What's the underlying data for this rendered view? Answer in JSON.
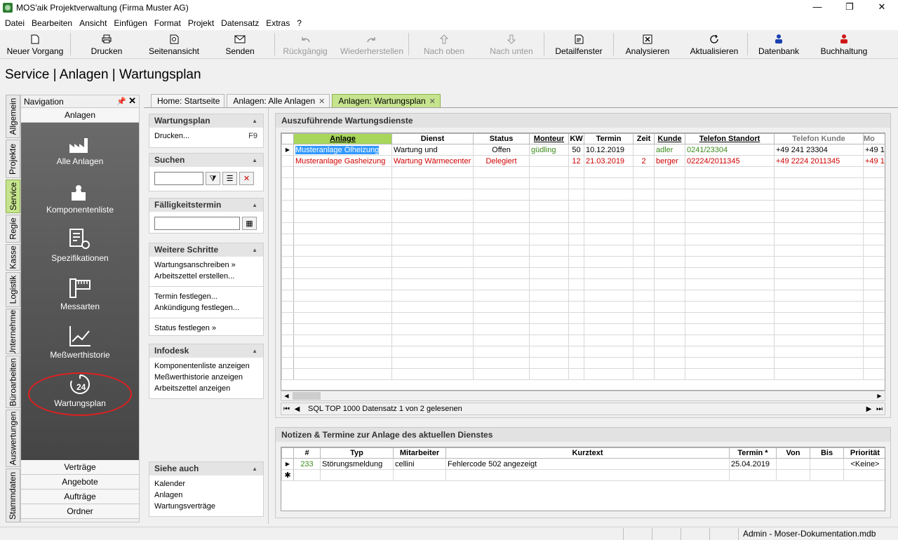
{
  "window": {
    "title": "MOS'aik Projektverwaltung (Firma Muster AG)",
    "minimize": "—",
    "maximize": "❐",
    "close": "✕"
  },
  "menu": [
    "Datei",
    "Bearbeiten",
    "Ansicht",
    "Einfügen",
    "Format",
    "Projekt",
    "Datensatz",
    "Extras",
    "?"
  ],
  "toolbar": {
    "new": "Neuer Vorgang",
    "print": "Drucken",
    "preview": "Seitenansicht",
    "send": "Senden",
    "undo": "Rückgängig",
    "redo": "Wiederherstellen",
    "up": "Nach oben",
    "down": "Nach unten",
    "detail": "Detailfenster",
    "analyze": "Analysieren",
    "refresh": "Aktualisieren",
    "database": "Datenbank",
    "accounting": "Buchhaltung"
  },
  "page_title": "Service | Anlagen | Wartungsplan",
  "vtabs": [
    "Allgemein",
    "Projekte",
    "Service",
    "Regie",
    "Kasse",
    "Logistik",
    "Unternehmer",
    "Büroarbeiten",
    "Auswertungen",
    "Stammdaten"
  ],
  "nav": {
    "header": "Navigation",
    "pin": "📌",
    "close": "✕",
    "section": "Anlagen",
    "items": [
      "Alle Anlagen",
      "Komponentenliste",
      "Spezifikationen",
      "Messarten",
      "Meßwerthistorie",
      "Wartungsplan"
    ],
    "bottom": [
      "Verträge",
      "Angebote",
      "Aufträge",
      "Ordner"
    ]
  },
  "tabs": [
    "Home: Startseite",
    "Anlagen: Alle Anlagen",
    "Anlagen: Wartungsplan"
  ],
  "task": {
    "wartungsplan": {
      "title": "Wartungsplan",
      "print": "Drucken...",
      "key": "F9"
    },
    "suchen": {
      "title": "Suchen"
    },
    "faellig": {
      "title": "Fälligkeitstermin"
    },
    "weitere": {
      "title": "Weitere Schritte",
      "items": [
        "Wartungsanschreiben »",
        "Arbeitszettel erstellen...",
        "Termin festlegen...",
        "Ankündigung festlegen...",
        "Status festlegen »"
      ]
    },
    "infodesk": {
      "title": "Infodesk",
      "items": [
        "Komponentenliste anzeigen",
        "Meßwerthistorie anzeigen",
        "Arbeitszettel anzeigen"
      ]
    },
    "siehe": {
      "title": "Siehe auch",
      "items": [
        "Kalender",
        "Anlagen",
        "Wartungsverträge"
      ]
    }
  },
  "main": {
    "title": "Auszuführende Wartungsdienste",
    "columns": [
      "Anlage",
      "Dienst",
      "Status",
      "Monteur",
      "KW",
      "Termin",
      "Zeit",
      "Kunde",
      "Telefon Standort",
      "Telefon Kunde",
      "Mo"
    ],
    "rows": [
      [
        "Musteranlage Ölheizung",
        "Wartung und",
        "Offen",
        "güdling",
        "50",
        "10.12.2019",
        "",
        "adler",
        "0241/23304",
        "+49 241 23304",
        "+49 1"
      ],
      [
        "Musteranlage Gasheizung",
        "Wartung Wärmecenter",
        "Delegiert",
        "",
        "12",
        "21.03.2019",
        "2",
        "berger",
        "02224/2011345",
        "+49 2224 2011345",
        "+49 1"
      ]
    ],
    "record_text": "SQL TOP 1000 Datensatz 1 von 2 gelesenen"
  },
  "notes": {
    "title": "Notizen & Termine zur Anlage des aktuellen Dienstes",
    "columns": [
      "#",
      "Typ",
      "Mitarbeiter",
      "Kurztext",
      "Termin *",
      "Von",
      "Bis",
      "Priorität"
    ],
    "rows": [
      [
        "233",
        "Störungsmeldung",
        "cellini",
        "Fehlercode 502 angezeigt",
        "25.04.2019",
        "",
        "",
        "<Keine>"
      ]
    ]
  },
  "status": {
    "text": "Admin - Moser-Dokumentation.mdb"
  },
  "colors": {
    "accent": "#c6e48e",
    "highlight": "#a8d65a",
    "warning": "#d00000",
    "ok": "#3a8c1a",
    "selection": "#3399ff"
  }
}
